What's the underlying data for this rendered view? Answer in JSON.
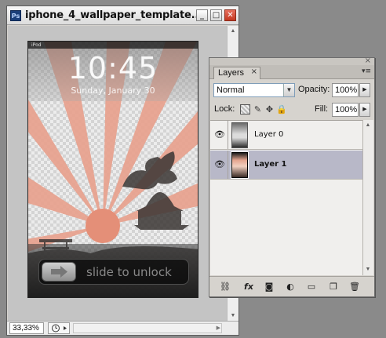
{
  "document": {
    "title": "iphone_4_wallpaper_template...",
    "app_badge": "Ps",
    "window_buttons": {
      "minimize": "_",
      "maximize": "□",
      "close": "✕"
    },
    "zoom_level": "33,33%"
  },
  "artwork": {
    "status_carrier": "iPod",
    "time": "10:45",
    "date": "Sunday, January 30",
    "slider_text": "slide to unlock"
  },
  "layers_panel": {
    "tab_label": "Layers",
    "tab_close": "×",
    "panel_close": "×",
    "blend_mode": "Normal",
    "opacity_label": "Opacity:",
    "opacity_value": "100%",
    "lock_label": "Lock:",
    "fill_label": "Fill:",
    "fill_value": "100%",
    "layers": [
      {
        "name": "Layer 0",
        "visible": true,
        "selected": false
      },
      {
        "name": "Layer 1",
        "visible": true,
        "selected": true
      }
    ],
    "footer_icons": [
      "link-icon",
      "fx-icon",
      "mask-icon",
      "adjustment-icon",
      "folder-icon",
      "new-layer-icon",
      "trash-icon"
    ]
  },
  "colors": {
    "selected_layer": "#b8b8c8",
    "sun_rays": "#e8a08c",
    "close_button": "#c3361f"
  }
}
